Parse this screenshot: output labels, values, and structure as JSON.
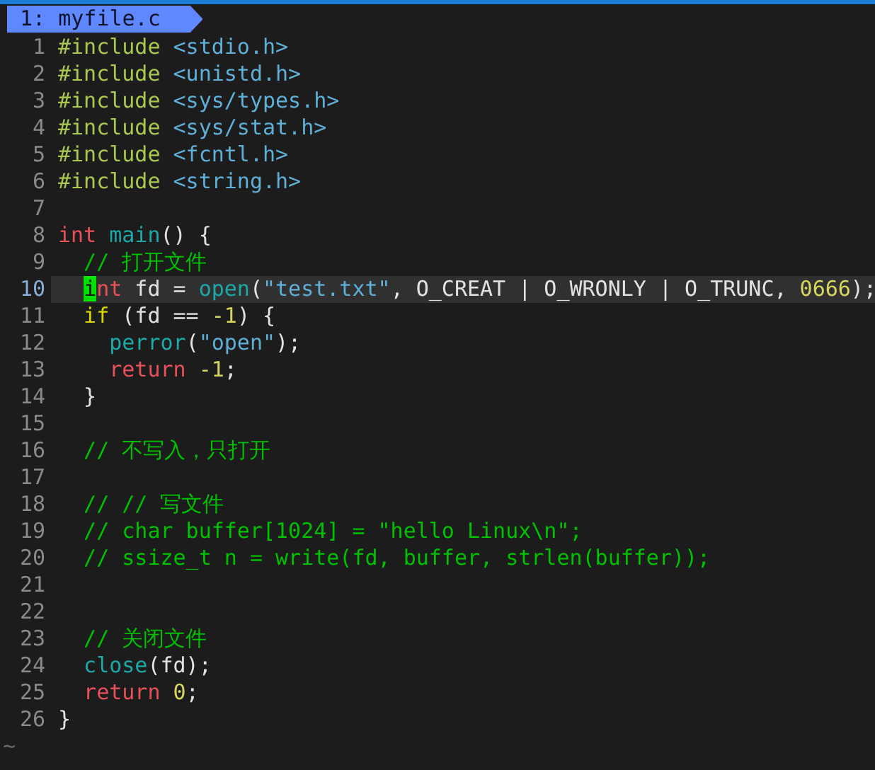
{
  "tab": {
    "label": " 1: myfile.c"
  },
  "lines": [
    {
      "number": "1",
      "selected": false,
      "tokens": [
        {
          "kind": "preproc",
          "text": "#include"
        },
        {
          "kind": "string",
          "text": " <stdio.h>"
        }
      ]
    },
    {
      "number": "2",
      "selected": false,
      "tokens": [
        {
          "kind": "preproc",
          "text": "#include"
        },
        {
          "kind": "string",
          "text": " <unistd.h>"
        }
      ]
    },
    {
      "number": "3",
      "selected": false,
      "tokens": [
        {
          "kind": "preproc",
          "text": "#include"
        },
        {
          "kind": "string",
          "text": " <sys/types.h>"
        }
      ]
    },
    {
      "number": "4",
      "selected": false,
      "tokens": [
        {
          "kind": "preproc",
          "text": "#include"
        },
        {
          "kind": "string",
          "text": " <sys/stat.h>"
        }
      ]
    },
    {
      "number": "5",
      "selected": false,
      "tokens": [
        {
          "kind": "preproc",
          "text": "#include"
        },
        {
          "kind": "string",
          "text": " <fcntl.h>"
        }
      ]
    },
    {
      "number": "6",
      "selected": false,
      "tokens": [
        {
          "kind": "preproc",
          "text": "#include"
        },
        {
          "kind": "string",
          "text": " <string.h>"
        }
      ]
    },
    {
      "number": "7",
      "selected": false
    },
    {
      "number": "8",
      "selected": false,
      "tokens": [
        {
          "kind": "type",
          "text": "int"
        },
        {
          "kind": "func",
          "text": " main"
        },
        {
          "kind": "plain",
          "text": "() {"
        }
      ]
    },
    {
      "number": "9",
      "selected": false,
      "tokens": [
        {
          "kind": "comment",
          "text": "  // 打开文件"
        }
      ]
    },
    {
      "number": "10",
      "selected": true,
      "tokens": [
        {
          "kind": "cursor",
          "text": "  i"
        },
        {
          "kind": "type",
          "text": "nt"
        },
        {
          "kind": "plain",
          "text": " fd = "
        },
        {
          "kind": "func",
          "text": "open"
        },
        {
          "kind": "plain",
          "text": "("
        },
        {
          "kind": "string",
          "text": "\"test.txt\""
        },
        {
          "kind": "plain",
          "text": ", O_CREAT | O_WRONLY | O_TRUNC, "
        },
        {
          "kind": "number",
          "text": "0666"
        },
        {
          "kind": "plain",
          "text": ");"
        }
      ]
    },
    {
      "number": "11",
      "selected": false,
      "tokens": [
        {
          "kind": "keyword",
          "text": "  if"
        },
        {
          "kind": "plain",
          "text": " (fd == "
        },
        {
          "kind": "number",
          "text": "-1"
        },
        {
          "kind": "plain",
          "text": ") {"
        }
      ]
    },
    {
      "number": "12",
      "selected": false,
      "tokens": [
        {
          "kind": "func",
          "text": "    perror"
        },
        {
          "kind": "plain",
          "text": "("
        },
        {
          "kind": "string",
          "text": "\"open\""
        },
        {
          "kind": "plain",
          "text": ");"
        }
      ]
    },
    {
      "number": "13",
      "selected": false,
      "tokens": [
        {
          "kind": "type",
          "text": "    return"
        },
        {
          "kind": "number",
          "text": " -1"
        },
        {
          "kind": "plain",
          "text": ";"
        }
      ]
    },
    {
      "number": "14",
      "selected": false,
      "tokens": [
        {
          "kind": "plain",
          "text": "  }"
        }
      ]
    },
    {
      "number": "15",
      "selected": false
    },
    {
      "number": "16",
      "selected": false,
      "tokens": [
        {
          "kind": "comment",
          "text": "  // 不写入，只打开"
        }
      ]
    },
    {
      "number": "17",
      "selected": false
    },
    {
      "number": "18",
      "selected": false,
      "tokens": [
        {
          "kind": "comment",
          "text": "  // // 写文件"
        }
      ]
    },
    {
      "number": "19",
      "selected": false,
      "tokens": [
        {
          "kind": "comment",
          "text": "  // char buffer[1024] = \"hello Linux\\n\";"
        }
      ]
    },
    {
      "number": "20",
      "selected": false,
      "tokens": [
        {
          "kind": "comment",
          "text": "  // ssize_t n = write(fd, buffer, strlen(buffer));"
        }
      ]
    },
    {
      "number": "21",
      "selected": false
    },
    {
      "number": "22",
      "selected": false
    },
    {
      "number": "23",
      "selected": false,
      "tokens": [
        {
          "kind": "comment",
          "text": "  // 关闭文件"
        }
      ]
    },
    {
      "number": "24",
      "selected": false,
      "tokens": [
        {
          "kind": "func",
          "text": "  close"
        },
        {
          "kind": "plain",
          "text": "(fd);"
        }
      ]
    },
    {
      "number": "25",
      "selected": false,
      "tokens": [
        {
          "kind": "type",
          "text": "  return"
        },
        {
          "kind": "number",
          "text": " 0"
        },
        {
          "kind": "plain",
          "text": ";"
        }
      ]
    },
    {
      "number": "26",
      "selected": false,
      "tokens": [
        {
          "kind": "plain",
          "text": "}"
        }
      ]
    }
  ],
  "filler": [
    "~"
  ]
}
